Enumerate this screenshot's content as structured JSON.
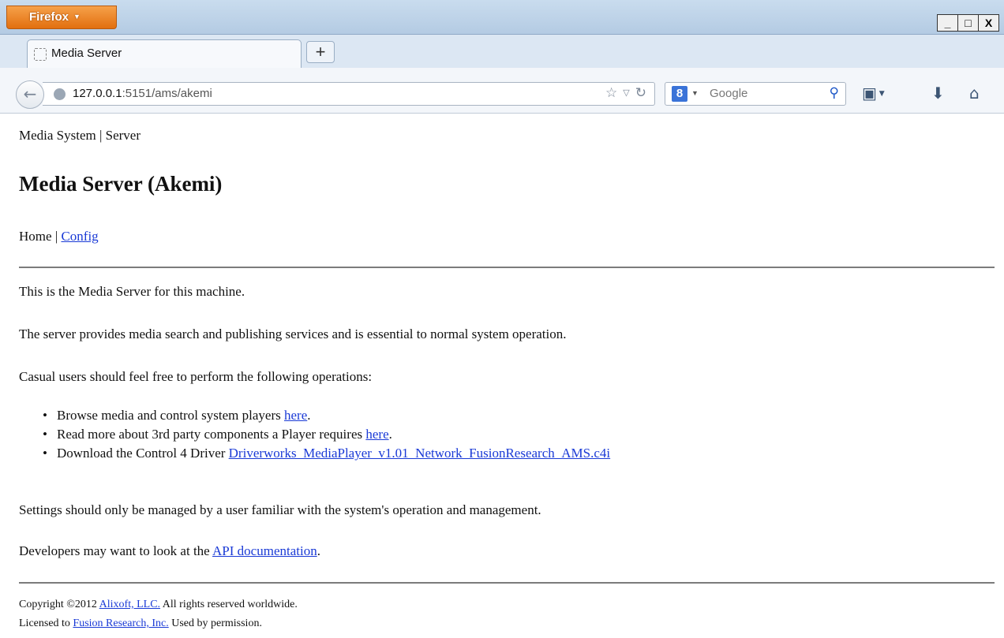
{
  "browser": {
    "app_button": "Firefox",
    "window_controls": {
      "minimize": "_",
      "maximize": "□",
      "close": "X"
    },
    "tab": {
      "title": "Media Server"
    },
    "new_tab": "+",
    "url": {
      "host": "127.0.0.1",
      "rest": ":5151/ams/akemi"
    },
    "search": {
      "engine_badge": "8",
      "placeholder": "Google"
    }
  },
  "page": {
    "breadcrumb": "Media System | Server",
    "title": "Media Server (Akemi)",
    "nav": {
      "home": "Home",
      "separator": " | ",
      "config": "Config"
    },
    "intro": "This is the Media Server for this machine.",
    "description": "The server provides media search and publishing services and is essential to normal system operation.",
    "casual_intro": "Casual users should feel free to perform the following operations:",
    "operations": [
      {
        "text": "Browse media and control system players ",
        "link": "here",
        "suffix": "."
      },
      {
        "text": "Read more about 3rd party components a Player requires ",
        "link": "here",
        "suffix": "."
      },
      {
        "text": "Download the Control 4 Driver ",
        "link": "Driverworks_MediaPlayer_v1.01_Network_FusionResearch_AMS.c4i",
        "suffix": ""
      }
    ],
    "settings_note": "Settings should only be managed by a user familiar with the system's operation and management.",
    "dev_note": {
      "text": "Developers may want to look at the ",
      "link": "API documentation",
      "suffix": "."
    },
    "footer": {
      "copyright_prefix": "Copyright ©2012 ",
      "copyright_link": "Alixoft, LLC.",
      "copyright_suffix": " All rights reserved worldwide.",
      "license_prefix": "Licensed to ",
      "license_link": "Fusion Research, Inc.",
      "license_suffix": " Used by permission."
    }
  }
}
